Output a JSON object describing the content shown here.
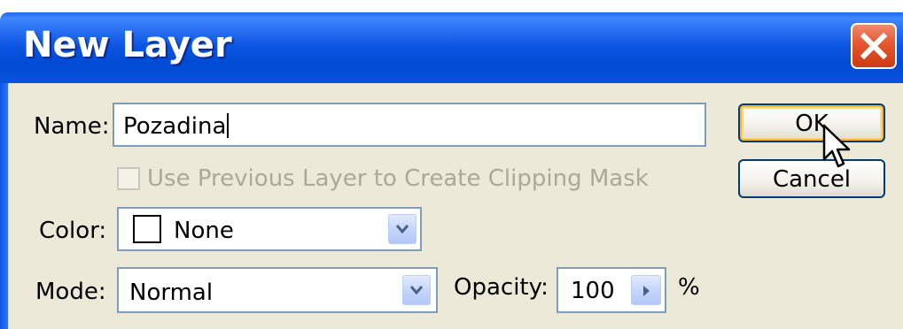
{
  "window": {
    "title": "New Layer",
    "close_icon": "close-x-icon"
  },
  "form": {
    "name_label": "Name:",
    "name_value": "Pozadina",
    "clipping_checkbox_label": "Use Previous Layer to Create Clipping Mask",
    "clipping_checked": false,
    "clipping_enabled": false,
    "color_label": "Color:",
    "color_value": "None",
    "mode_label": "Mode:",
    "mode_value": "Normal",
    "opacity_label": "Opacity:",
    "opacity_value": "100",
    "opacity_unit": "%"
  },
  "buttons": {
    "ok_label": "OK",
    "cancel_label": "Cancel"
  },
  "icons": {
    "close": "close-icon",
    "dropdown": "chevron-down-icon",
    "stepper": "triangle-right-icon",
    "cursor": "mouse-pointer-icon"
  },
  "colors": {
    "title_bar": "#0b55e2",
    "dialog_bg": "#ece9d8",
    "close_button": "#e5552f",
    "field_border": "#7f9db9",
    "default_button_highlight": "#f8b330",
    "disabled_text": "#aca899"
  }
}
